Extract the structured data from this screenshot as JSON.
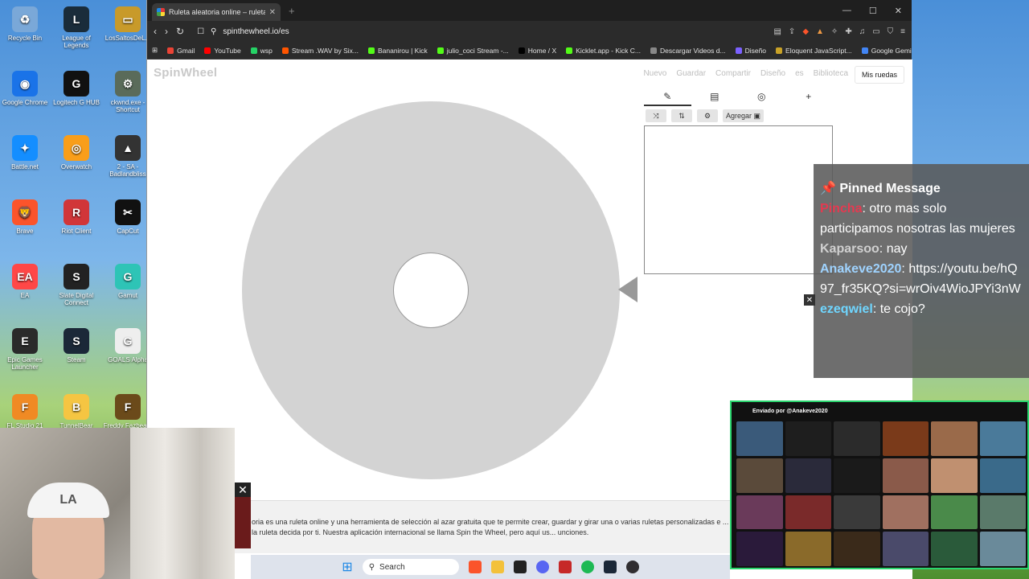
{
  "desktop": {
    "icons": [
      {
        "label": "Recycle Bin",
        "color": "#7aa8d8",
        "glyph": "♻"
      },
      {
        "label": "League of Legends",
        "color": "#1a2c3a",
        "glyph": "L"
      },
      {
        "label": "LosSaltosDeL...",
        "color": "#c89a2a",
        "glyph": "▭"
      },
      {
        "label": "Google Chrome",
        "color": "#1a73e8",
        "glyph": "◉"
      },
      {
        "label": "Logitech G HUB",
        "color": "#111111",
        "glyph": "G"
      },
      {
        "label": "ckwnd.exe - Shortcut",
        "color": "#5a6b5a",
        "glyph": "⚙"
      },
      {
        "label": "Battle.net",
        "color": "#148eff",
        "glyph": "✦"
      },
      {
        "label": "Overwatch",
        "color": "#f99e1a",
        "glyph": "◎"
      },
      {
        "label": "2 - SA - Badlandbliss",
        "color": "#333333",
        "glyph": "▲"
      },
      {
        "label": "Brave",
        "color": "#fb542b",
        "glyph": "🦁"
      },
      {
        "label": "Riot Client",
        "color": "#d13639",
        "glyph": "R"
      },
      {
        "label": "CapCut",
        "color": "#111111",
        "glyph": "✂"
      },
      {
        "label": "EA",
        "color": "#ff4747",
        "glyph": "EA"
      },
      {
        "label": "Slate Digital Connect",
        "color": "#222222",
        "glyph": "S"
      },
      {
        "label": "Gamut",
        "color": "#2ec4b6",
        "glyph": "G"
      },
      {
        "label": "Epic Games Launcher",
        "color": "#2a2a2a",
        "glyph": "E"
      },
      {
        "label": "Steam",
        "color": "#1b2838",
        "glyph": "S"
      },
      {
        "label": "GOALS Alpha",
        "color": "#eeeeee",
        "glyph": "G"
      },
      {
        "label": "FL Studio 21",
        "color": "#f08a24",
        "glyph": "F"
      },
      {
        "label": "TunnelBear",
        "color": "#f5c542",
        "glyph": "B"
      },
      {
        "label": "Freddy Fazbea...",
        "color": "#6b4a1a",
        "glyph": "F"
      }
    ]
  },
  "browser": {
    "tab_title": "Ruleta aleatoria online – ruleta d...",
    "tab_close": "✕",
    "new_tab": "+",
    "window_controls": [
      "—",
      "☐",
      "✕"
    ],
    "url": "spinthewheel.io/es",
    "bookmarks": [
      {
        "label": "Gmail",
        "color": "#ea4335"
      },
      {
        "label": "YouTube",
        "color": "#ff0000"
      },
      {
        "label": "wsp",
        "color": "#25d366"
      },
      {
        "label": "Stream .WAV by Six...",
        "color": "#ff5500"
      },
      {
        "label": "Bananirou | Kick",
        "color": "#53fc18"
      },
      {
        "label": "julio_coci Stream -...",
        "color": "#53fc18"
      },
      {
        "label": "Home / X",
        "color": "#000000"
      },
      {
        "label": "Kicklet.app - Kick C...",
        "color": "#53fc18"
      },
      {
        "label": "Descargar Videos d...",
        "color": "#888888"
      },
      {
        "label": "Diseño",
        "color": "#7b61ff"
      },
      {
        "label": "Eloquent JavaScript...",
        "color": "#c9a227"
      },
      {
        "label": "Google Gemini",
        "color": "#4285f4"
      }
    ],
    "more_bookmarks": "»"
  },
  "page": {
    "logo": "SpinWheel",
    "menu": [
      "Nuevo",
      "Guardar",
      "Compartir",
      "Diseño",
      "es",
      "Biblioteca"
    ],
    "my_wheels": "Mis ruedas",
    "panel_tabs": [
      "✎",
      "▤",
      "◎",
      "+"
    ],
    "entry_buttons": [
      "⤨",
      "⇅",
      "⚙",
      "Agregar ▣"
    ],
    "description": "oria es una ruleta online y una herramienta de selección al azar gratuita que te permite crear, guardar y girar una o varias ruletas personalizadas e ... adas, aplica temas y cambia los sonidos, y deja que la ruleta decida por ti. Nuestra aplicación internacional se llama Spin the Wheel, pero aquí us... unciones."
  },
  "chat": {
    "pinned_label": "Pinned Message",
    "messages": [
      {
        "user": "Pincha",
        "text": ": otro mas solo participamos nosotras las mujeres"
      },
      {
        "user": "Kaparsoo",
        "text": ": nay"
      },
      {
        "user": "Anakeve2020",
        "text": ": https://youtu.be/hQ97_fr35KQ?si=wrOiv4WioJPYi3nW"
      },
      {
        "user": "ezeqwiel",
        "text": ": te cojo?"
      }
    ],
    "close": "✕"
  },
  "video": {
    "header": "Enviado por @Anakeve2020"
  },
  "webcam": {
    "cap_logo": "LA",
    "close": "✕"
  },
  "taskbar": {
    "search_label": "Search"
  }
}
